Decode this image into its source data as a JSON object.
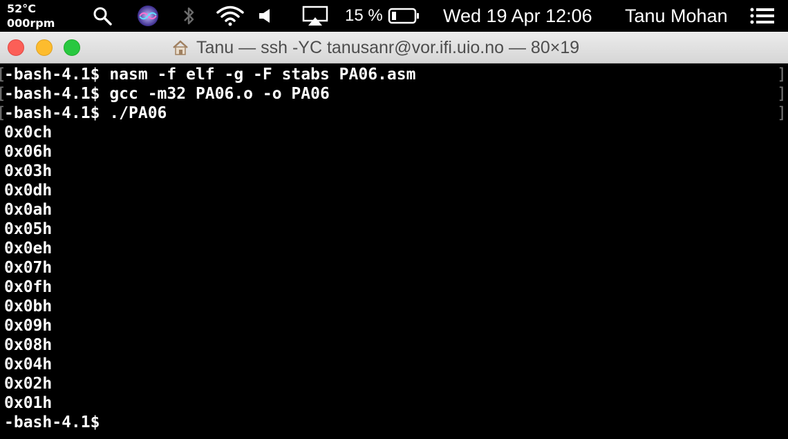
{
  "menubar": {
    "temperature": "52°C",
    "fan_speed": "000rpm",
    "battery_percent": "15 %",
    "datetime": "Wed 19 Apr  12:06",
    "user": "Tanu Mohan",
    "icons": [
      "search-icon",
      "siri-icon",
      "bluetooth-icon",
      "wifi-icon",
      "volume-icon",
      "airplay-icon",
      "battery-icon",
      "notification-center-icon"
    ]
  },
  "window": {
    "title": "Tanu — ssh -YC tanusanr@vor.ifi.uio.no — 80×19"
  },
  "terminal": {
    "commands": [
      "-bash-4.1$ nasm -f elf -g -F stabs PA06.asm",
      "-bash-4.1$ gcc -m32 PA06.o -o PA06",
      "-bash-4.1$ ./PA06"
    ],
    "output": [
      "0x0ch",
      "0x06h",
      "0x03h",
      "0x0dh",
      "0x0ah",
      "0x05h",
      "0x0eh",
      "0x07h",
      "0x0fh",
      "0x0bh",
      "0x09h",
      "0x08h",
      "0x04h",
      "0x02h",
      "0x01h"
    ],
    "prompt": "-bash-4.1$"
  },
  "colors": {
    "terminal_bg": "#000000",
    "terminal_fg": "#ffffff",
    "close": "#fc5f57",
    "minimize": "#fdbc2e",
    "zoom": "#28c840"
  }
}
